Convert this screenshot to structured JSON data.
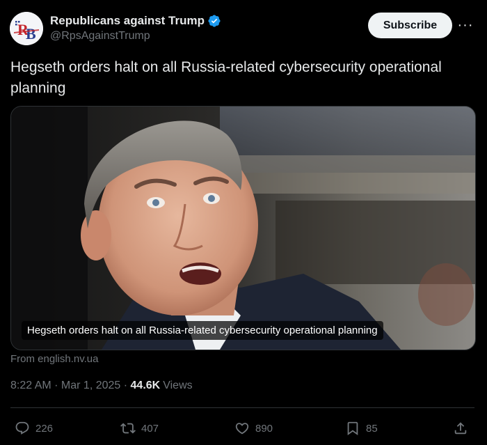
{
  "author": {
    "display_name": "Republicans against Trump",
    "handle": "@RpsAgainstTrump",
    "avatar_text": "RB",
    "verified": true
  },
  "subscribe_label": "Subscribe",
  "more_label": "···",
  "post": {
    "text": "Hegseth orders halt on all Russia-related cybersecurity operational planning",
    "media_caption": "Hegseth orders halt on all Russia-related cybersecurity operational planning",
    "source": "From english.nv.ua"
  },
  "meta": {
    "time": "8:22 AM",
    "separator": " · ",
    "date": "Mar 1, 2025",
    "views_count": "44.6K",
    "views_label": "Views"
  },
  "actions": {
    "replies": "226",
    "reposts": "407",
    "likes": "890",
    "bookmarks": "85"
  },
  "colors": {
    "background": "#000000",
    "text": "#e7e9ea",
    "muted": "#71767b",
    "verified": "#1d9bf0",
    "divider": "#2f3336"
  },
  "icons": [
    "verified-badge-icon",
    "more-icon",
    "reply-icon",
    "repost-icon",
    "like-icon",
    "bookmark-icon",
    "share-icon"
  ]
}
